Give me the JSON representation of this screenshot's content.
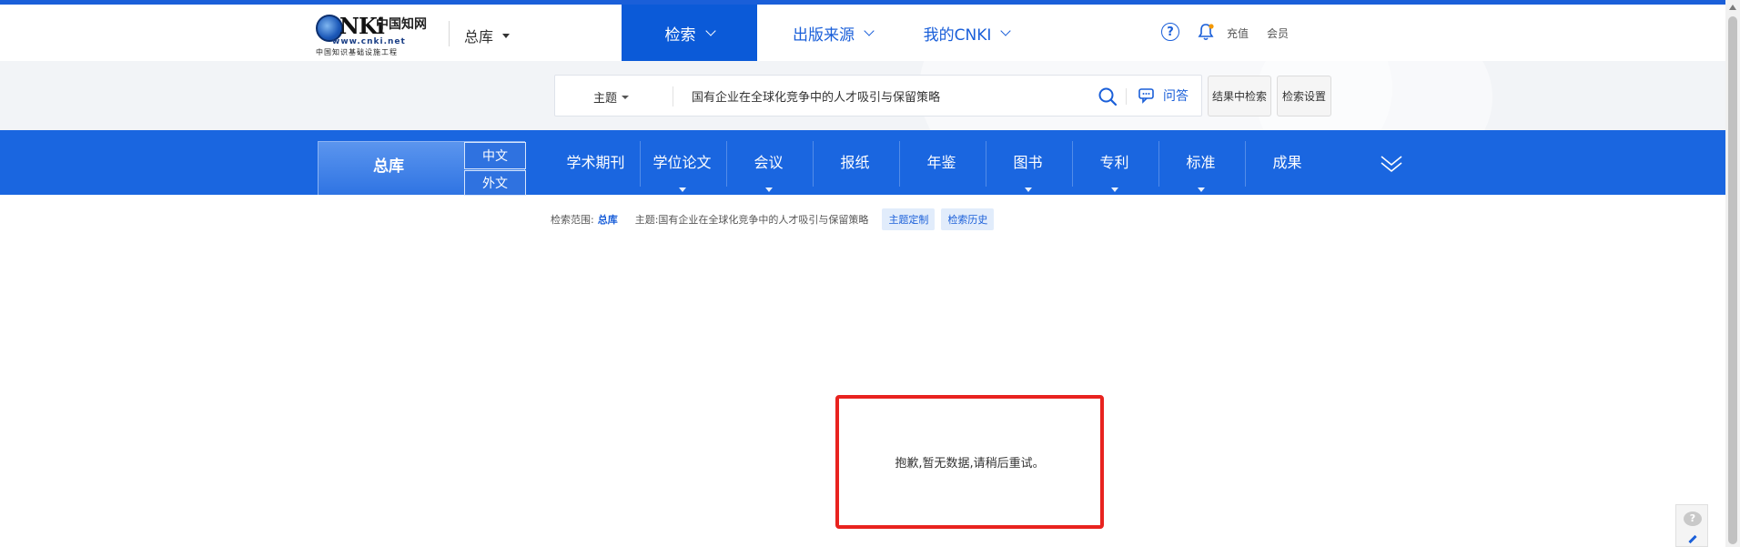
{
  "logo": {
    "brand": "NKi",
    "cn_name": "中国知网",
    "url": "www.cnki.net",
    "subtitle": "中国知识基础设施工程"
  },
  "db_select": {
    "label": "总库"
  },
  "nav": {
    "tabs": [
      {
        "label": "检索"
      },
      {
        "label": "出版来源"
      },
      {
        "label": "我的CNKI"
      }
    ],
    "help_glyph": "?",
    "recharge": "充值",
    "member": "会员"
  },
  "search": {
    "field": "主题",
    "query": "国有企业在全球化竞争中的人才吸引与保留策略",
    "qa_label": "问答",
    "in_results_label": "结果中检索",
    "settings_label": "检索设置"
  },
  "categories": {
    "main": "总库",
    "lang_cn": "中文",
    "lang_foreign": "外文",
    "items": [
      {
        "label": "学术期刊"
      },
      {
        "label": "学位论文"
      },
      {
        "label": "会议"
      },
      {
        "label": "报纸"
      },
      {
        "label": "年鉴"
      },
      {
        "label": "图书"
      },
      {
        "label": "专利"
      },
      {
        "label": "标准"
      },
      {
        "label": "成果"
      }
    ]
  },
  "breadcrumb": {
    "scope_label": "检索范围:",
    "scope_value": "总库",
    "topic_text": "主题:国有企业在全球化竞争中的人才吸引与保留策略",
    "custom_label": "主题定制",
    "history_label": "检索历史"
  },
  "message": {
    "text": "抱歉,暂无数据,请稍后重试。"
  },
  "colors": {
    "accent": "#1a5fd9",
    "band": "#1a66e0",
    "highlight_border": "#e8231f"
  }
}
